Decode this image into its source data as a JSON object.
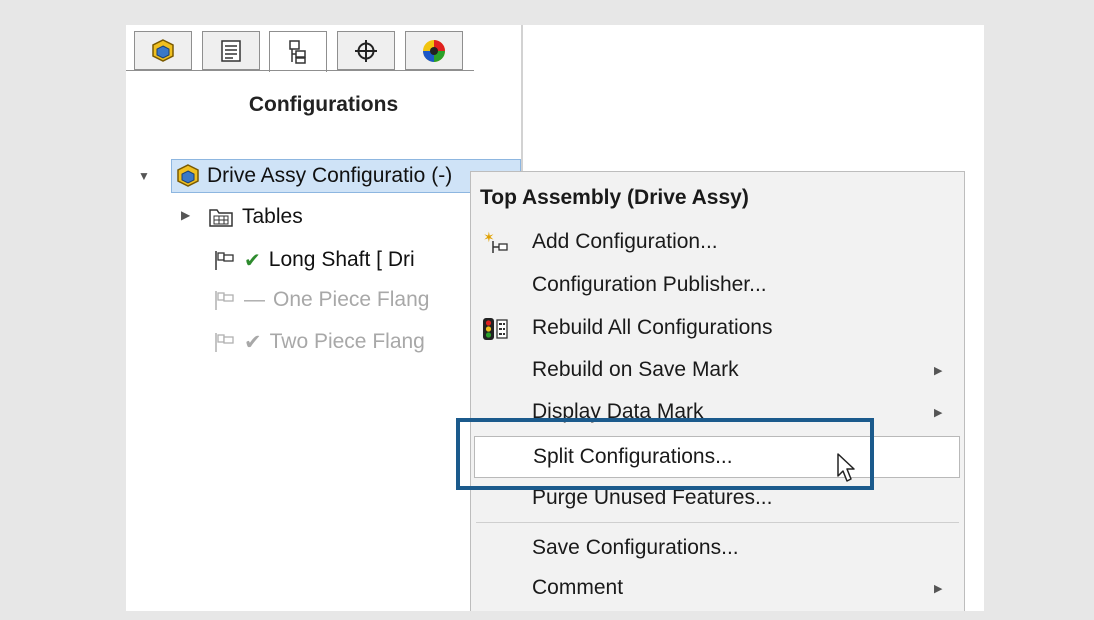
{
  "tabs": [
    {
      "name": "feature-manager",
      "icon": "assembly-icon"
    },
    {
      "name": "property-manager",
      "icon": "property-list-icon"
    },
    {
      "name": "configuration-manager",
      "icon": "configuration-tree-icon",
      "active": true
    },
    {
      "name": "dimxpert-manager",
      "icon": "crosshair-icon"
    },
    {
      "name": "display-manager",
      "icon": "color-wheel-icon"
    }
  ],
  "panel": {
    "title": "Configurations"
  },
  "tree": {
    "root": "Drive Assy Configuratio",
    "root_suffix": "(-)",
    "tables": "Tables",
    "configs": [
      {
        "label": "Long Shaft [ Dri",
        "state": "active",
        "mark": "✔"
      },
      {
        "label": "One Piece Flang",
        "state": "inactive",
        "mark": "—"
      },
      {
        "label": "Two Piece Flang",
        "state": "inactive",
        "mark": "✔"
      }
    ]
  },
  "menu": {
    "header": "Top Assembly (Drive Assy)",
    "items": [
      {
        "label": "Add Configuration...",
        "icon": "add-configuration-icon",
        "submenu": false
      },
      {
        "label": "Configuration Publisher...",
        "submenu": false
      },
      {
        "label": "Rebuild All Configurations",
        "icon": "traffic-light-icon",
        "submenu": false
      },
      {
        "label": "Rebuild on Save Mark",
        "submenu": true
      },
      {
        "label": "Display Data Mark",
        "submenu": true
      },
      {
        "label": "Split Configurations...",
        "submenu": false,
        "hovered": true
      },
      {
        "label": "Purge Unused Features...",
        "submenu": false
      },
      {
        "label": "Save Configurations...",
        "submenu": false
      },
      {
        "label": "Comment",
        "submenu": true
      }
    ]
  },
  "colors": {
    "highlight_border": "#1b5a8c",
    "selection_bg": "#cfe3f7",
    "check_green": "#2e8b2e"
  }
}
